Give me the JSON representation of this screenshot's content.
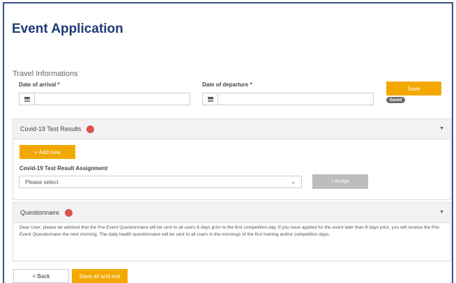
{
  "page": {
    "title": "Event Application"
  },
  "travel": {
    "section_title": "Travel Informations",
    "arrival_label": "Date of arrival *",
    "departure_label": "Date of departure *",
    "arrival_value": "",
    "departure_value": "",
    "save_label": "Save",
    "saved_badge": "Saved"
  },
  "covid": {
    "title": "Covid-19 Test Results",
    "add_new_label": "+ Add new",
    "assignment_label": "Covid-19 Test Result Assignment",
    "select_value": "Please select",
    "assign_label": "+ Assign"
  },
  "questionnaire": {
    "title": "Questionnaire",
    "text": "Dear User, please be advised that the Pre-Event Questionnaire will be sent to all users 6 days prior to the first competition day. If you have applied for the event later than 6 days prior, you will receive the Pre-Event Questionnaire the next morning. The daily health questionnaire will be sent to all users in the mornings of the first training and/or competition days."
  },
  "footer": {
    "back_label": "< Back",
    "save_exit_label": "Save all and exit"
  },
  "colors": {
    "accent": "#f3a800",
    "title": "#1e3a78",
    "status_dot": "#d9534f"
  }
}
